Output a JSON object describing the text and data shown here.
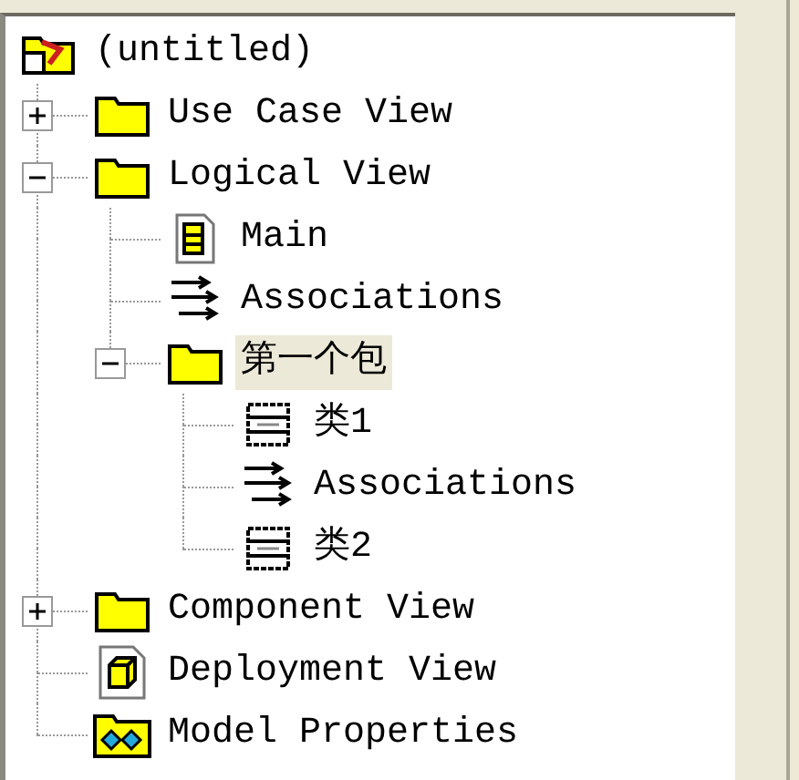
{
  "tree": {
    "label": "(untitled)",
    "kind": "root",
    "selected": false,
    "children": [
      {
        "label": "Use Case View",
        "kind": "folder",
        "selected": false,
        "expanded": false
      },
      {
        "label": "Logical View",
        "kind": "folder",
        "selected": false,
        "expanded": true,
        "children": [
          {
            "label": "Main",
            "kind": "diagram",
            "selected": false
          },
          {
            "label": "Associations",
            "kind": "associations",
            "selected": false
          },
          {
            "label": "第一个包",
            "kind": "folder",
            "selected": true,
            "expanded": true,
            "children": [
              {
                "label": "类1",
                "kind": "class",
                "selected": false
              },
              {
                "label": "Associations",
                "kind": "associations",
                "selected": false
              },
              {
                "label": "类2",
                "kind": "class",
                "selected": false
              }
            ]
          }
        ]
      },
      {
        "label": "Component View",
        "kind": "folder",
        "selected": false,
        "expanded": false
      },
      {
        "label": "Deployment View",
        "kind": "deployment",
        "selected": false
      },
      {
        "label": "Model Properties",
        "kind": "properties",
        "selected": false
      }
    ]
  }
}
